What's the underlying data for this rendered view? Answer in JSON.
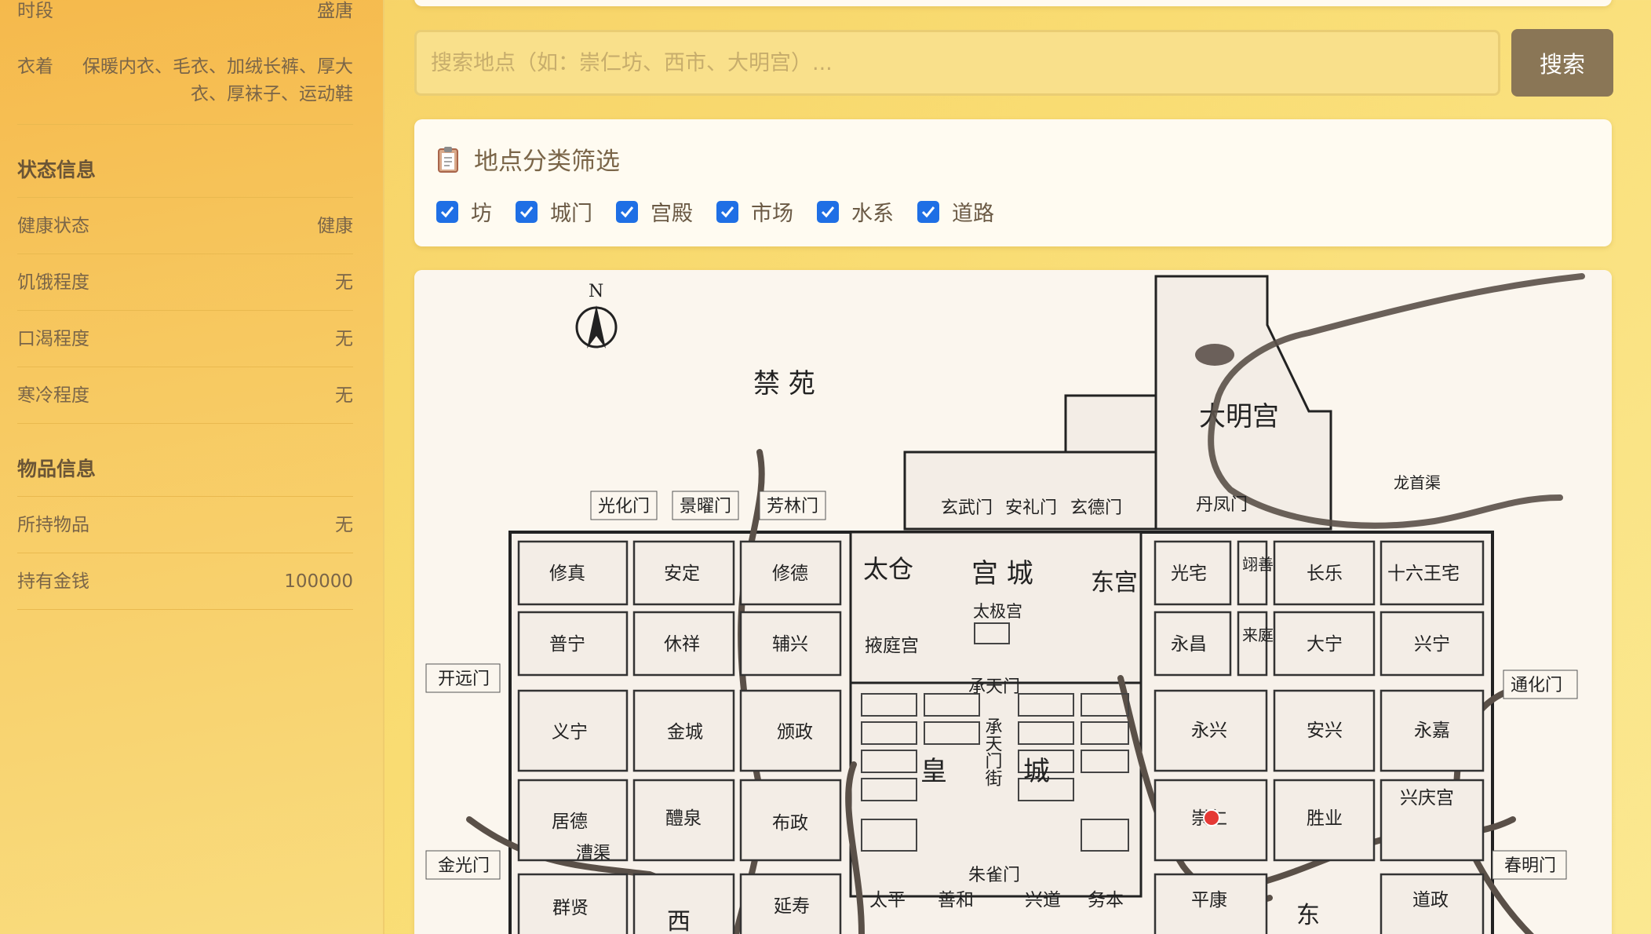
{
  "sidebar": {
    "period": {
      "label": "时段",
      "value": "盛唐"
    },
    "clothing": {
      "label": "衣着",
      "value": "保暖内衣、毛衣、加绒长裤、厚大衣、厚袜子、运动鞋"
    },
    "status_section": "状态信息",
    "status": [
      {
        "label": "健康状态",
        "value": "健康"
      },
      {
        "label": "饥饿程度",
        "value": "无"
      },
      {
        "label": "口渴程度",
        "value": "无"
      },
      {
        "label": "寒冷程度",
        "value": "无"
      }
    ],
    "items_section": "物品信息",
    "items": [
      {
        "label": "所持物品",
        "value": "无"
      },
      {
        "label": "持有金钱",
        "value": "100000"
      }
    ]
  },
  "search": {
    "placeholder": "搜索地点（如：崇仁坊、西市、大明宫）...",
    "button": "搜索"
  },
  "filter": {
    "icon": "clipboard-icon",
    "title": "地点分类筛选",
    "options": [
      {
        "label": "坊",
        "checked": true
      },
      {
        "label": "城门",
        "checked": true
      },
      {
        "label": "宫殿",
        "checked": true
      },
      {
        "label": "市场",
        "checked": true
      },
      {
        "label": "水系",
        "checked": true
      },
      {
        "label": "道路",
        "checked": true
      }
    ]
  },
  "map": {
    "north": "N",
    "jinyuan": "禁 苑",
    "daming": "大明宫",
    "longshouqu": "龙首渠",
    "gates": {
      "guanghua": "光化门",
      "jingyao": "景曜门",
      "fanglin": "芳林门",
      "xuanwu": "玄武门",
      "anli": "安礼门",
      "xuande": "玄德门",
      "danfeng": "丹凤门",
      "kaiyuan": "开远门",
      "tonghua": "通化门",
      "jinguang": "金光门",
      "chunming": "春明门",
      "chengtian": "承天门",
      "zhuque": "朱雀门"
    },
    "wards": {
      "xiuzhen": "修真",
      "anding": "安定",
      "xiude": "修德",
      "puning": "普宁",
      "xiuxiang": "休祥",
      "fuxing": "辅兴",
      "yining": "义宁",
      "jincheng": "金城",
      "songzheng": "颁政",
      "jude": "居德",
      "liquan": "醴泉",
      "buzheng": "布政",
      "qunxian": "群贤",
      "yanshou": "延寿",
      "guangzhai": "光宅",
      "yishan": "翊善",
      "changle": "长乐",
      "shiliuwang": "十六王宅",
      "yongchang": "永昌",
      "laiting": "来庭",
      "daning": "大宁",
      "xingning": "兴宁",
      "yongxing": "永兴",
      "anxing": "安兴",
      "yongjia": "永嘉",
      "chongren": "崇仁",
      "shengye": "胜业",
      "xingqing": "兴庆宫",
      "taiping": "太平",
      "shanhe": "善和",
      "xingdao": "兴道",
      "wuben": "务本",
      "pingkang": "平康",
      "daozheng": "道政"
    },
    "palace": {
      "taicang": "太仓",
      "gongcheng": "宫 城",
      "donggong": "东宫",
      "taiji": "太极宫",
      "yeting": "掖庭宫",
      "huang": "皇",
      "cheng": "城",
      "chengtianmenjie": "承天门街"
    },
    "water": {
      "caoqu": "漕渠"
    },
    "markets": {
      "xi": "西",
      "dong": "东"
    },
    "marker_color": "#e53935"
  },
  "colors": {
    "accent_button": "#8a7656",
    "checkbox": "#1f6fe5"
  }
}
